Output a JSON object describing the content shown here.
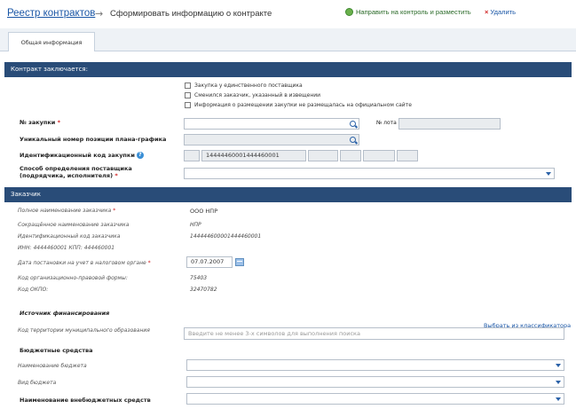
{
  "header": {
    "breadcrumb_link": "Реестр контрактов",
    "breadcrumb_arrow": "→",
    "breadcrumb_current": "Сформировать информацию о контракте",
    "action_send": "Направить на контроль и разместить",
    "action_delete": "Удалить"
  },
  "tabs": [
    {
      "label": "Общая информация"
    }
  ],
  "section_contract": {
    "title": "Контракт заключается:",
    "checkboxes": [
      {
        "label": "Закупка у единственного поставщика",
        "checked": false
      },
      {
        "label": "Сменился заказчик, указанный в извещении",
        "checked": false
      },
      {
        "label": "Информация о размещении закупки не размещалась на официальном сайте",
        "checked": false
      }
    ],
    "purchase_number_label": "№ закупки",
    "required_mark": "*",
    "lot_label": "№ лота",
    "plan_position_label": "Уникальный номер позиции плана-графика",
    "ikz_label": "Идентификационный код закупки",
    "ikz_help_icon": "?",
    "ikz_value": "14444460001444460001",
    "supplier_method_label": "Способ определения поставщика (подрядчика, исполнителя)"
  },
  "section_customer": {
    "title": "Заказчик",
    "full_name_label": "Полное наименование заказчика",
    "full_name_value": "ООО НПР",
    "short_name_label": "Сокращённое наименование заказчика",
    "short_name_value": "НПР",
    "id_code_label": "Идентификационный код заказчика",
    "id_code_value": "144444600001444460001",
    "inn_kpp": "ИНН: 4444460001 КПП: 444460001",
    "tax_date_label": "Дата постановки на учет в налоговом органе",
    "tax_date_value": "07.07.2007",
    "okopf_label": "Код организационно-правовой формы:",
    "okopf_value": "75403",
    "okpo_label": "Код ОКПО:",
    "okpo_value": "32470782"
  },
  "financing": {
    "title": "Источник финансирования",
    "select_from_classifier": "Выбрать из классификатора",
    "municipal_label": "Код территории муниципального образования",
    "municipal_placeholder": "Введите не менее 3-х символов для выполнения поиска",
    "budget_funds_title": "Бюджетные средства",
    "budget_name_label": "Наименование бюджета",
    "budget_type_label": "Вид бюджета",
    "extrabudget_label": "Наименование внебюджетных средств"
  }
}
